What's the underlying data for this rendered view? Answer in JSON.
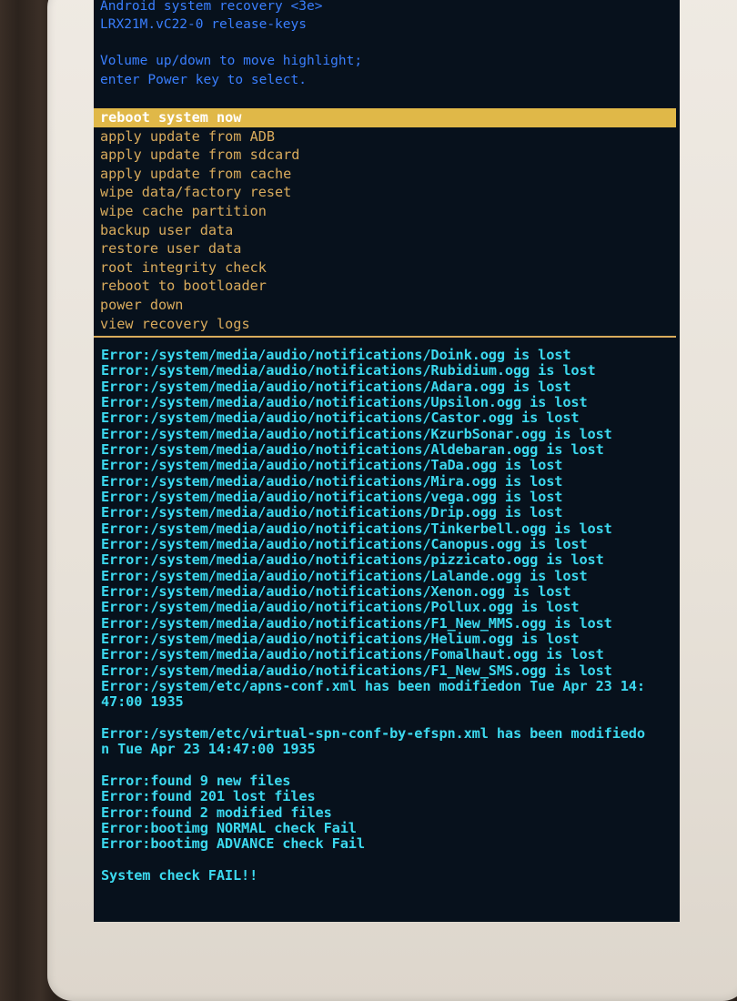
{
  "header": {
    "line1": "Android system recovery <3e>",
    "line2": "LRX21M.vC22-0 release-keys",
    "line3": "Volume up/down to move highlight;",
    "line4": "enter Power key to select."
  },
  "menu": {
    "items": [
      "reboot system now",
      "apply update from ADB",
      "apply update from sdcard",
      "apply update from cache",
      "wipe data/factory reset",
      "wipe cache partition",
      "backup user data",
      "restore user data",
      "root integrity check",
      "reboot to bootloader",
      "power down",
      "view recovery logs"
    ],
    "selected_index": 0
  },
  "log": {
    "lines": [
      "Error:/system/media/audio/notifications/Doink.ogg is lost",
      "Error:/system/media/audio/notifications/Rubidium.ogg is lost",
      "Error:/system/media/audio/notifications/Adara.ogg is lost",
      "Error:/system/media/audio/notifications/Upsilon.ogg is lost",
      "Error:/system/media/audio/notifications/Castor.ogg is lost",
      "Error:/system/media/audio/notifications/KzurbSonar.ogg is lost",
      "Error:/system/media/audio/notifications/Aldebaran.ogg is lost",
      "Error:/system/media/audio/notifications/TaDa.ogg is lost",
      "Error:/system/media/audio/notifications/Mira.ogg is lost",
      "Error:/system/media/audio/notifications/vega.ogg is lost",
      "Error:/system/media/audio/notifications/Drip.ogg is lost",
      "Error:/system/media/audio/notifications/Tinkerbell.ogg is lost",
      "Error:/system/media/audio/notifications/Canopus.ogg is lost",
      "Error:/system/media/audio/notifications/pizzicato.ogg is lost",
      "Error:/system/media/audio/notifications/Lalande.ogg is lost",
      "Error:/system/media/audio/notifications/Xenon.ogg is lost",
      "Error:/system/media/audio/notifications/Pollux.ogg is lost",
      "Error:/system/media/audio/notifications/F1_New_MMS.ogg is lost",
      "Error:/system/media/audio/notifications/Helium.ogg is lost",
      "Error:/system/media/audio/notifications/Fomalhaut.ogg is lost",
      "Error:/system/media/audio/notifications/F1_New_SMS.ogg is lost",
      "Error:/system/etc/apns-conf.xml has been modifiedon Tue Apr 23 14:",
      "47:00 1935",
      "",
      "Error:/system/etc/virtual-spn-conf-by-efspn.xml has been modifiedo",
      "n Tue Apr 23 14:47:00 1935",
      "",
      "Error:found 9 new files",
      "Error:found 201 lost files",
      "Error:found 2 modified files",
      "Error:bootimg NORMAL check Fail",
      "Error:bootimg ADVANCE check Fail",
      "",
      "System check FAIL!!"
    ]
  },
  "colors": {
    "screen_bg": "#07111c",
    "header_text": "#3a7fff",
    "menu_text": "#d9ab5c",
    "menu_highlight": "#e0b848",
    "log_text": "#3cd9ef"
  }
}
